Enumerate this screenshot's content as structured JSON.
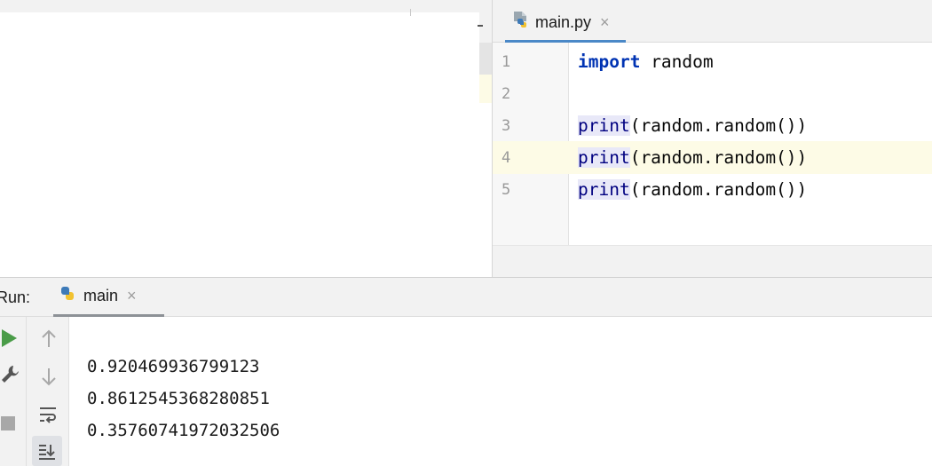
{
  "editor": {
    "tab": {
      "label": "main.py",
      "close": "×"
    },
    "line_numbers": [
      "1",
      "2",
      "3",
      "4",
      "5"
    ],
    "lines": [
      {
        "keyword": "import",
        "rest": " random"
      },
      {
        "text": ""
      },
      {
        "fn": "print",
        "rest": "(random.random())"
      },
      {
        "fn": "print",
        "rest": "(random.random())"
      },
      {
        "fn": "print",
        "rest": "(random.random())"
      }
    ]
  },
  "run": {
    "label": "Run:",
    "tab": {
      "label": "main",
      "close": "×"
    },
    "output": [
      "0.920469936799123",
      "0.8612545368280851",
      "0.35760741972032506"
    ]
  },
  "icons": {
    "python_file": "python-file-icon",
    "python": "python-icon",
    "run": "run-icon",
    "wrench": "wrench-icon",
    "stop": "stop-icon",
    "up": "arrow-up-icon",
    "down": "arrow-down-icon",
    "wrap": "soft-wrap-icon",
    "scroll_end": "scroll-to-end-icon"
  },
  "colors": {
    "keyword": "#0033b3",
    "builtin": "#000080",
    "builtin_bg": "#e8e8f8",
    "current_line": "#fdfbe6",
    "tab_underline": "#4a88c7",
    "run_green": "#4a9c48"
  }
}
